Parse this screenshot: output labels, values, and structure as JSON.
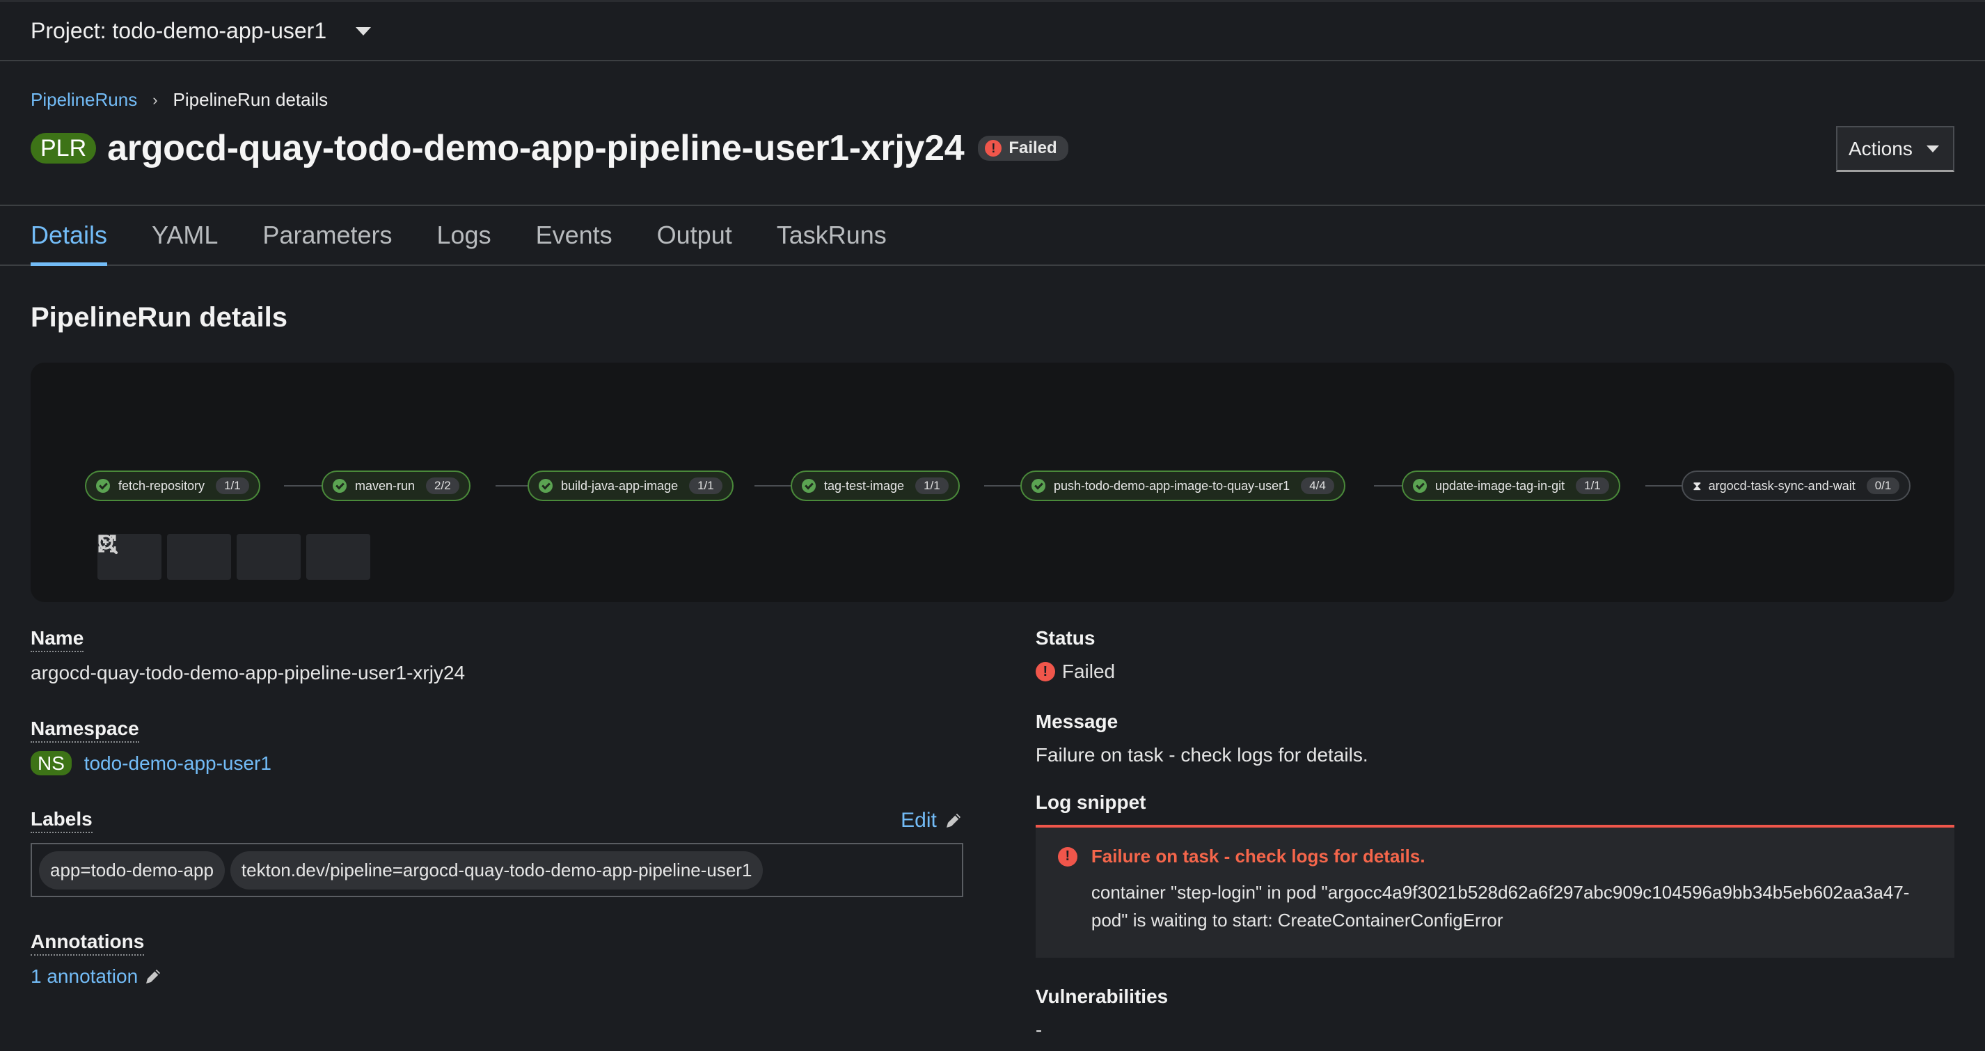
{
  "topbar": {
    "project_label": "Project: todo-demo-app-user1"
  },
  "breadcrumb": {
    "parent": "PipelineRuns",
    "current": "PipelineRun details"
  },
  "header": {
    "badge": "PLR",
    "title": "argocd-quay-todo-demo-app-pipeline-user1-xrjy24",
    "status": "Failed",
    "actions_label": "Actions"
  },
  "tabs": [
    {
      "label": "Details",
      "active": true
    },
    {
      "label": "YAML"
    },
    {
      "label": "Parameters"
    },
    {
      "label": "Logs"
    },
    {
      "label": "Events"
    },
    {
      "label": "Output"
    },
    {
      "label": "TaskRuns"
    }
  ],
  "section_title": "PipelineRun details",
  "pipeline": {
    "tasks": [
      {
        "name": "fetch-repository",
        "count": "1/1",
        "state": "succeeded"
      },
      {
        "name": "maven-run",
        "count": "2/2",
        "state": "succeeded"
      },
      {
        "name": "build-java-app-image",
        "count": "1/1",
        "state": "succeeded"
      },
      {
        "name": "tag-test-image",
        "count": "1/1",
        "state": "succeeded"
      },
      {
        "name": "push-todo-demo-app-image-to-quay-user1",
        "count": "4/4",
        "state": "succeeded"
      },
      {
        "name": "update-image-tag-in-git",
        "count": "1/1",
        "state": "succeeded"
      },
      {
        "name": "argocd-task-sync-and-wait",
        "count": "0/1",
        "state": "pending"
      }
    ],
    "controls": [
      "zoom-in-icon",
      "zoom-out-icon",
      "fit-to-screen-icon",
      "expand-icon"
    ]
  },
  "details": {
    "name_label": "Name",
    "name_value": "argocd-quay-todo-demo-app-pipeline-user1-xrjy24",
    "namespace_label": "Namespace",
    "namespace_badge": "NS",
    "namespace_value": "todo-demo-app-user1",
    "labels_label": "Labels",
    "labels_edit": "Edit",
    "labels": [
      "app=todo-demo-app",
      "tekton.dev/pipeline=argocd-quay-todo-demo-app-pipeline-user1"
    ],
    "annotations_label": "Annotations",
    "annotations_link": "1 annotation",
    "status_label": "Status",
    "status_value": "Failed",
    "message_label": "Message",
    "message_value": "Failure on task - check logs for details.",
    "log_snippet_label": "Log snippet",
    "log_snippet_title": "Failure on task - check logs for details.",
    "log_snippet_body": "container \"step-login\" in pod \"argocc4a9f3021b528d62a6f297abc909c104596a9bb34b5eb602aa3a47-pod\" is waiting to start: CreateContainerConfigError",
    "vulnerabilities_label": "Vulnerabilities",
    "vulnerabilities_value": "-"
  },
  "colors": {
    "link": "#73bcf7",
    "success": "#5ba352",
    "danger": "#f0564b",
    "badge_green": "#3d7317"
  }
}
